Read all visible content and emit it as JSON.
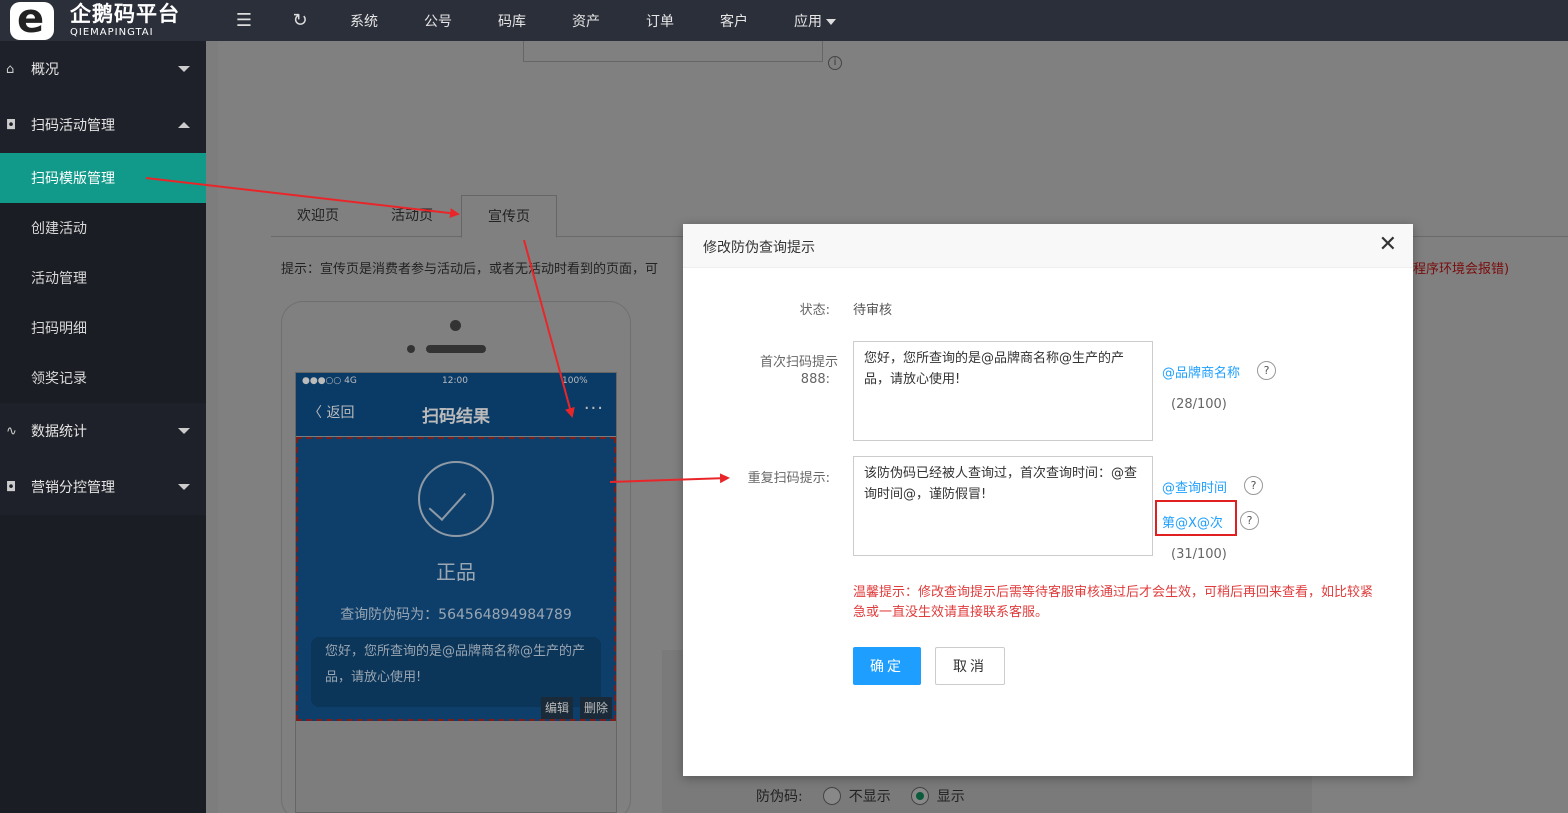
{
  "brand": {
    "name_cn": "企鹅码平台",
    "name_en": "QIEMAPINGTAI"
  },
  "topnav": {
    "items": [
      "系统",
      "公号",
      "码库",
      "资产",
      "订单",
      "客户",
      "应用"
    ]
  },
  "sidebar": {
    "groups": [
      {
        "label": "概况"
      },
      {
        "label": "扫码活动管理"
      },
      {
        "label": "数据统计"
      },
      {
        "label": "营销分控管理"
      }
    ],
    "sub_items": [
      "扫码模版管理",
      "创建活动",
      "活动管理",
      "扫码明细",
      "领奖记录"
    ]
  },
  "tabs": [
    "欢迎页",
    "活动页",
    "宣传页"
  ],
  "tip": {
    "left": "提示：宣传页是消费者参与活动后，或者无活动时看到的页面，可",
    "right": "程序环境会报错)"
  },
  "phone": {
    "status_left": "●●●○○ 4G",
    "status_time": "12:00",
    "status_battery": "100%",
    "back": "〈 返回",
    "title": "扫码结果",
    "more": "···",
    "result": "正品",
    "query_code": "查询防伪码为：564564894984789",
    "message": "您好，您所查询的是@品牌商名称@生产的产品，请放心使用!",
    "edit": "编辑",
    "delete": "删除"
  },
  "background_form": {
    "label": "防伪码:",
    "options": [
      "不显示",
      "显示"
    ]
  },
  "modal": {
    "title": "修改防伪查询提示",
    "status_label": "状态:",
    "status_value": "待审核",
    "first_label_line1": "首次扫码提示",
    "first_label_line2": "888:",
    "first_text": "您好，您所查询的是@品牌商名称@生产的产品，请放心使用!",
    "first_link": "@品牌商名称",
    "first_count": "(28/100)",
    "repeat_label": "重复扫码提示:",
    "repeat_text": "该防伪码已经被人查询过，首次查询时间：@查询时间@，谨防假冒!",
    "repeat_link1": "@查询时间",
    "repeat_link2": "第@X@次",
    "repeat_count": "(31/100)",
    "warning": "温馨提示：修改查询提示后需等待客服审核通过后才会生效，可稍后再回来查看，如比较紧急或一直没生效请直接联系客服。",
    "ok": "确定",
    "cancel": "取消",
    "question_mark": "?"
  },
  "colors": {
    "accent": "#1e9fff",
    "active_menu": "#119a8a",
    "warning": "#e03c3c",
    "annotation": "#e02020"
  }
}
